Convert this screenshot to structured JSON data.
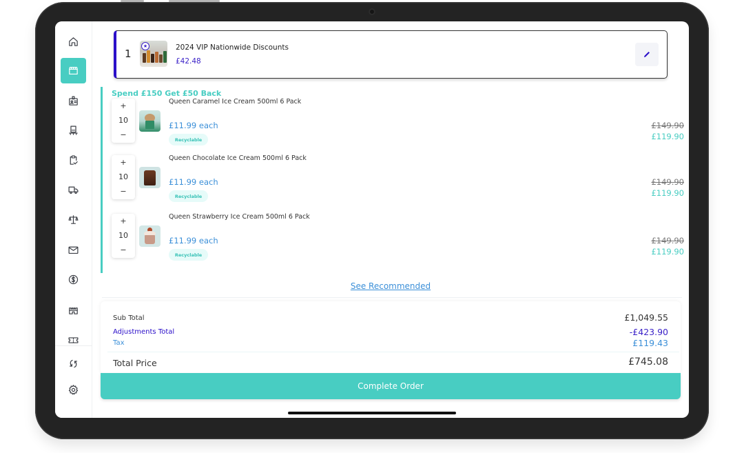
{
  "promo": {
    "index": "1",
    "title": "2024 VIP Nationwide Discounts",
    "price": "£42.48",
    "badge_icon": "star-circle-icon",
    "edit_icon": "pencil-icon"
  },
  "group": {
    "title": "Spend £150 Get £50 Back",
    "items": [
      {
        "name": "Queen Caramel Ice Cream 500ml 6 Pack",
        "quantity": "10",
        "unit_price": "£11.99 each",
        "tag": "Recyclable",
        "original_total": "£149.90",
        "discounted_total": "£119.90",
        "plus": "+",
        "minus": "−"
      },
      {
        "name": "Queen Chocolate Ice Cream 500ml 6 Pack",
        "quantity": "10",
        "unit_price": "£11.99 each",
        "tag": "Recyclable",
        "original_total": "£149.90",
        "discounted_total": "£119.90",
        "plus": "+",
        "minus": "−"
      },
      {
        "name": "Queen Strawberry Ice Cream 500ml 6 Pack",
        "quantity": "10",
        "unit_price": "£11.99 each",
        "tag": "Recyclable",
        "original_total": "£149.90",
        "discounted_total": "£119.90",
        "plus": "+",
        "minus": "−"
      }
    ]
  },
  "see_recommended": "See Recommended",
  "totals": {
    "subtotal_label": "Sub Total",
    "subtotal_value": "£1,049.55",
    "adjustments_label": "Adjustments Total",
    "adjustments_value": "-£423.90",
    "tax_label": "Tax",
    "tax_value": "£119.43",
    "total_label": "Total Price",
    "total_value": "£745.08"
  },
  "complete_order": "Complete Order",
  "sidebar": {
    "items": [
      {
        "icon": "home-icon",
        "active": false
      },
      {
        "icon": "store-icon",
        "active": true
      },
      {
        "icon": "id-badge-icon",
        "active": false
      },
      {
        "icon": "kiosk-icon",
        "active": false
      },
      {
        "icon": "clipboard-check-icon",
        "active": false
      },
      {
        "icon": "truck-icon",
        "active": false
      },
      {
        "icon": "scales-icon",
        "active": false
      },
      {
        "icon": "mail-icon",
        "active": false
      },
      {
        "icon": "dollar-circle-icon",
        "active": false
      },
      {
        "icon": "castle-icon",
        "active": false
      },
      {
        "icon": "ticket-icon",
        "active": false
      },
      {
        "icon": "sync-icon",
        "active": false
      },
      {
        "icon": "settings-icon",
        "active": false
      }
    ]
  },
  "colors": {
    "accent": "#48cdc2",
    "brand_purple": "#2b0fc9",
    "link_blue": "#3b8fd8",
    "text": "#222222"
  }
}
